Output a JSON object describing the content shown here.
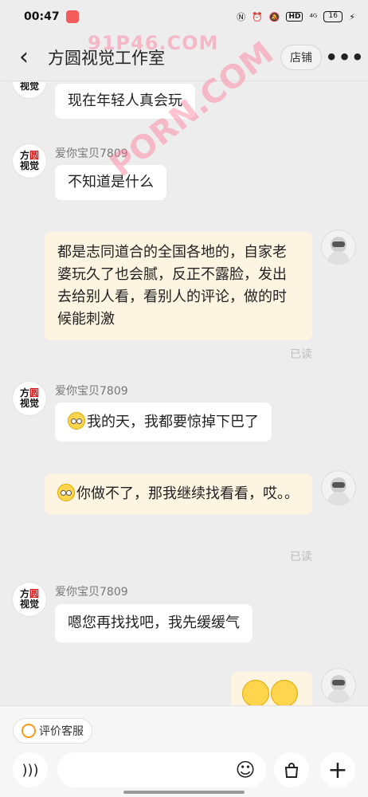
{
  "status_bar": {
    "time": "00:47",
    "signal": "⁴ᴳ",
    "battery": "16"
  },
  "header": {
    "title": "方圆视觉工作室",
    "store_label": "店铺"
  },
  "avatar_text": {
    "line1_a": "方",
    "line1_b": "圆",
    "line2": "视觉"
  },
  "messages": [
    {
      "side": "in",
      "sender": "",
      "text": "现在年轻人真会玩"
    },
    {
      "side": "in",
      "sender": "爱你宝贝7809",
      "text": "不知道是什么"
    },
    {
      "side": "out",
      "text": "都是志同道合的全国各地的，自家老婆玩久了也会腻，反正不露脸，发出去给别人看，看别人的评论，做的时候能刺激",
      "status": "已读"
    },
    {
      "side": "in",
      "sender": "爱你宝贝7809",
      "text": "我的天，我都要惊掉下巴了"
    },
    {
      "side": "out",
      "text": "你做不了，那我继续找看看，哎。。",
      "status": "已读"
    },
    {
      "side": "in",
      "sender": "爱你宝贝7809",
      "text": "嗯您再找找吧，我先缓缓气"
    },
    {
      "side": "out",
      "text": ""
    }
  ],
  "bottom_bar": {
    "rate_label": "评价客服",
    "input_placeholder": ""
  },
  "watermarks": {
    "top": "91P46.COM",
    "diagonal": "PORN.COM"
  },
  "colors": {
    "incoming_bubble": "#ffffff",
    "outgoing_bubble": "#fdf4e1",
    "background": "#ededed",
    "avatar_red": "#d01a1a"
  },
  "icons": [
    "back-icon",
    "more-icon",
    "voice-icon",
    "emoji-icon",
    "bag-icon",
    "plus-icon",
    "smile-icon"
  ]
}
